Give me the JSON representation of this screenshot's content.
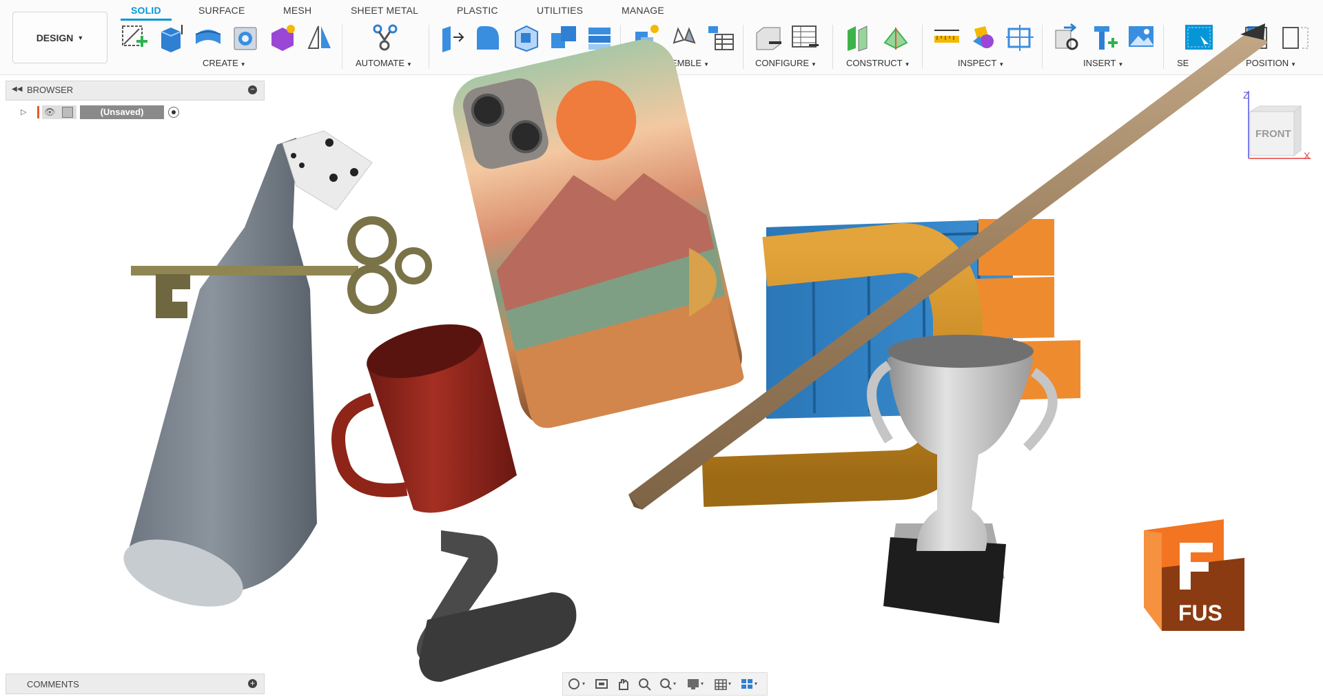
{
  "workspace": {
    "label": "DESIGN"
  },
  "tabs": [
    "SOLID",
    "SURFACE",
    "MESH",
    "SHEET METAL",
    "PLASTIC",
    "UTILITIES",
    "MANAGE"
  ],
  "active_tab": "SOLID",
  "groups": {
    "create": "CREATE",
    "automate": "AUTOMATE",
    "assemble": "ASSEMBLE",
    "configure": "CONFIGURE",
    "construct": "CONSTRUCT",
    "inspect": "INSPECT",
    "insert": "INSERT",
    "select": "SE",
    "position": "POSITION"
  },
  "browser": {
    "title": "BROWSER",
    "item_name": "(Unsaved)"
  },
  "comments": {
    "title": "COMMENTS"
  },
  "viewcube": {
    "face": "FRONT",
    "axis_z": "Z",
    "axis_x": "X"
  },
  "logo": {
    "text": "FUS",
    "letter": "F"
  },
  "colors": {
    "accent": "#0696d7",
    "brand_orange": "#f37421",
    "brand_dark": "#8a3b12"
  }
}
